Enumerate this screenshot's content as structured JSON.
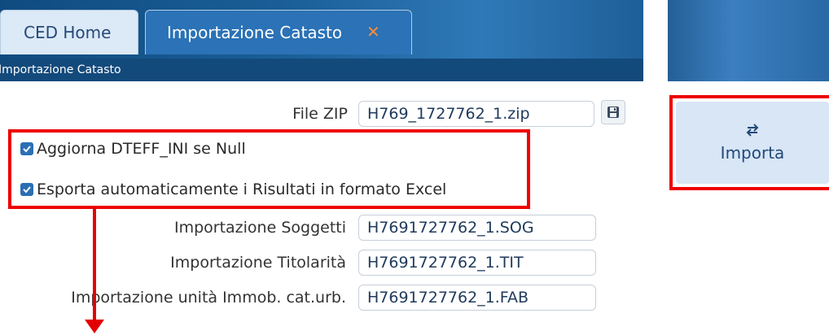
{
  "tabs": [
    {
      "label": "CED Home"
    },
    {
      "label": "Importazione Catasto",
      "close_glyph": "✕"
    }
  ],
  "subtitle": "Importazione Catasto",
  "form": {
    "file_zip": {
      "label": "File ZIP",
      "value": "H769_1727762_1.zip"
    },
    "checkbox_aggiorna": {
      "label": "Aggiorna DTEFF_INI se Null",
      "checked": true
    },
    "checkbox_esporta": {
      "label": "Esporta automaticamente i Risultati in formato Excel",
      "checked": true
    },
    "soggetti": {
      "label": "Importazione Soggetti",
      "value": "H7691727762_1.SOG"
    },
    "titolarita": {
      "label": "Importazione Titolarità",
      "value": "H7691727762_1.TIT"
    },
    "unita": {
      "label": "Importazione unità Immob. cat.urb.",
      "value": "H7691727762_1.FAB"
    }
  },
  "buttons": {
    "importa_label": "Importa"
  },
  "icons": {
    "save": "save-icon",
    "swap": "swap-arrows-icon",
    "close": "close-icon"
  },
  "colors": {
    "highlight": "#ee0000",
    "accent": "#2b72b6",
    "close": "#ff8c3a"
  }
}
